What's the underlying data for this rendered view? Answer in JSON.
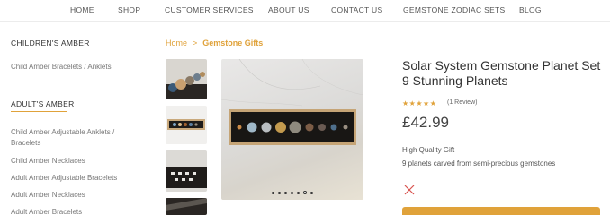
{
  "nav": {
    "home": "HOME",
    "shop": "SHOP",
    "customer_services": "CUSTOMER SERVICES",
    "about": "ABOUT US",
    "contact": "CONTACT US",
    "zodiac": "GEMSTONE ZODIAC SETS",
    "blog": "BLOG"
  },
  "sidebar": {
    "childrens_heading": "CHILDREN'S AMBER",
    "childrens_items": [
      "Child Amber Bracelets / Anklets"
    ],
    "adults_heading": "ADULT'S AMBER",
    "adults_items": [
      "Child Amber Adjustable Anklets / Bracelets",
      "Child Amber Necklaces",
      "Adult Amber Adjustable Bracelets",
      "Adult Amber Necklaces",
      "Adult Amber Bracelets"
    ]
  },
  "breadcrumb": {
    "home": "Home",
    "separator": ">",
    "current": "Gemstone Gifts"
  },
  "product": {
    "title": "Solar System Gemstone Planet Set 9 Stunning Planets",
    "stars": "★★★★★",
    "rating": 5,
    "reviews": "(1 Review)",
    "price": "£42.99",
    "features": [
      "High Quality Gift",
      "9 planets carved from semi-precious gemstones"
    ]
  },
  "gallery": {
    "slide_count": 7,
    "active_slide": 6
  },
  "colors": {
    "accent": "#e0a23a",
    "close": "#d9534f"
  }
}
